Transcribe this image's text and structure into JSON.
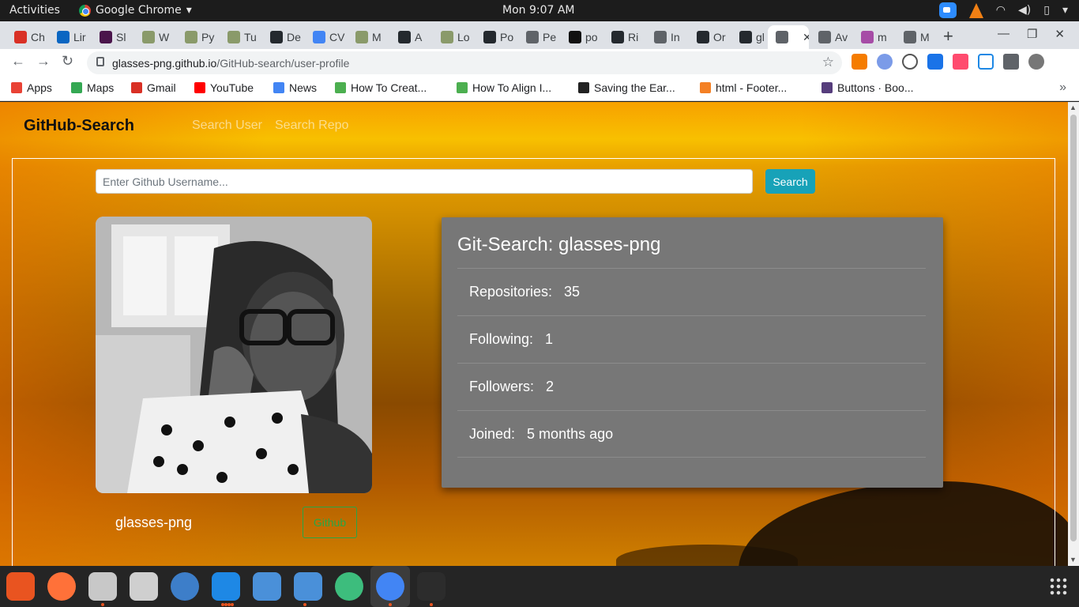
{
  "system_bar": {
    "activities": "Activities",
    "app_name": "Google Chrome",
    "clock": "Mon  9:07 AM"
  },
  "tabs": [
    {
      "label": "Ch",
      "icon": "gmail-icon",
      "color": "#d93025"
    },
    {
      "label": "Lir",
      "icon": "linkedin-icon",
      "color": "#0a66c2"
    },
    {
      "label": "Sl",
      "icon": "slack-icon",
      "color": "#4a154b"
    },
    {
      "label": "W",
      "icon": "palm-icon",
      "color": "#8a9a6a"
    },
    {
      "label": "Py",
      "icon": "palm-icon",
      "color": "#8a9a6a"
    },
    {
      "label": "Tu",
      "icon": "palm-icon",
      "color": "#8a9a6a"
    },
    {
      "label": "De",
      "icon": "github-icon",
      "color": "#24292e"
    },
    {
      "label": "CV",
      "icon": "docs-icon",
      "color": "#4285f4"
    },
    {
      "label": "M",
      "icon": "palm-icon",
      "color": "#8a9a6a"
    },
    {
      "label": "A",
      "icon": "github-icon",
      "color": "#24292e"
    },
    {
      "label": "Lo",
      "icon": "palm-icon",
      "color": "#8a9a6a"
    },
    {
      "label": "Po",
      "icon": "github-icon",
      "color": "#24292e"
    },
    {
      "label": "Pe",
      "icon": "globe-icon",
      "color": "#5f6368"
    },
    {
      "label": "po",
      "icon": "circle-icon",
      "color": "#111111"
    },
    {
      "label": "Ri",
      "icon": "github-icon",
      "color": "#24292e"
    },
    {
      "label": "In",
      "icon": "globe-icon",
      "color": "#5f6368"
    },
    {
      "label": "Or",
      "icon": "github-icon",
      "color": "#24292e"
    },
    {
      "label": "gl",
      "icon": "github-icon",
      "color": "#24292e"
    },
    {
      "label": "",
      "icon": "globe-icon",
      "color": "#5f6368",
      "active": true
    },
    {
      "label": "Av",
      "icon": "globe-icon",
      "color": "#5f6368"
    },
    {
      "label": "m",
      "icon": "h-icon",
      "color": "#a64ca6"
    },
    {
      "label": "M",
      "icon": "globe-icon",
      "color": "#5f6368"
    }
  ],
  "omnibox": {
    "host": "glasses-png.github.io",
    "path": "/GitHub-search/user-profile"
  },
  "bookmarks": [
    {
      "label": "Apps",
      "icon": "apps-grid-icon",
      "color": "#e94235"
    },
    {
      "label": "Maps",
      "icon": "maps-pin-icon",
      "color": "#34a853"
    },
    {
      "label": "Gmail",
      "icon": "gmail-icon",
      "color": "#d93025"
    },
    {
      "label": "YouTube",
      "icon": "youtube-icon",
      "color": "#ff0000"
    },
    {
      "label": "News",
      "icon": "news-icon",
      "color": "#4285f4"
    },
    {
      "label": "How To Creat...",
      "icon": "chart-icon",
      "color": "#4caf50"
    },
    {
      "label": "How To Align I...",
      "icon": "chart-icon",
      "color": "#4caf50"
    },
    {
      "label": "Saving the Ear...",
      "icon": "g-arrow-icon",
      "color": "#222222"
    },
    {
      "label": "html - Footer...",
      "icon": "stackoverflow-icon",
      "color": "#f48024"
    },
    {
      "label": "Buttons · Boo...",
      "icon": "bootstrap-icon",
      "color": "#563d7c"
    }
  ],
  "site": {
    "brand": "GitHub-Search",
    "nav": [
      "Search User",
      "Search Repo"
    ],
    "search": {
      "placeholder": "Enter Github Username...",
      "button": "Search"
    },
    "profile": {
      "username": "glasses-png",
      "github_button": "Github"
    },
    "card": {
      "title": "Git-Search: glasses-png",
      "stats": [
        {
          "label": "Repositories:",
          "value": "35"
        },
        {
          "label": "Following:",
          "value": "1"
        },
        {
          "label": "Followers:",
          "value": "2"
        },
        {
          "label": "Joined:",
          "value": "5 months ago"
        }
      ]
    }
  },
  "dock": [
    {
      "name": "software-center-icon",
      "color": "#e95420"
    },
    {
      "name": "firefox-icon",
      "color": "#ff7139"
    },
    {
      "name": "files-icon",
      "color": "#c8c8c8"
    },
    {
      "name": "webcam-icon",
      "color": "#cfcfcf"
    },
    {
      "name": "help-icon",
      "color": "#3d7ec9"
    },
    {
      "name": "vscode-icon",
      "color": "#1e88e5"
    },
    {
      "name": "document-viewer-icon",
      "color": "#4a90d9"
    },
    {
      "name": "mail-icon",
      "color": "#4a90d9"
    },
    {
      "name": "atom-icon",
      "color": "#3dbd7d"
    },
    {
      "name": "chrome-icon",
      "color": "#4285f4"
    },
    {
      "name": "terminal-icon",
      "color": "#2c2c2c"
    }
  ]
}
